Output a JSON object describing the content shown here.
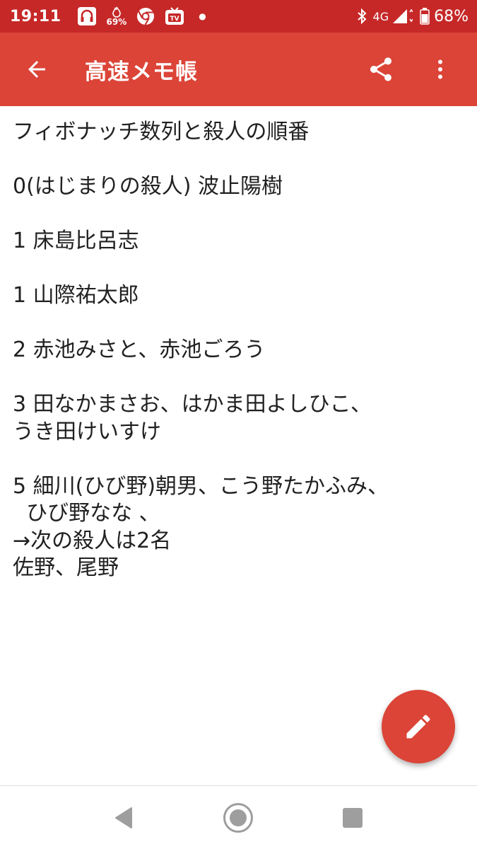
{
  "status_bar": {
    "time": "19:11",
    "notification_icons": [
      "media-app-icon",
      "fire-percent-icon",
      "chrome-icon",
      "tv-app-icon",
      "more-dot-icon"
    ],
    "fire_percent": "69%",
    "network_label": "4G",
    "battery_percent": "68%",
    "background_color": "#c62828"
  },
  "app_bar": {
    "title": "高速メモ帳",
    "background_color": "#db4437",
    "back_icon": "arrow-back-icon",
    "share_icon": "share-icon",
    "overflow_icon": "more-vert-icon"
  },
  "memo": {
    "text": "フィボナッチ数列と殺人の順番\n\n0(はじまりの殺人) 波止陽樹\n\n1 床島比呂志\n\n1 山際祐太郎\n\n2 赤池みさと、赤池ごろう\n\n3 田なかまさお、はかま田よしひこ、\nうき田けいすけ\n\n5 細川(ひび野)朝男、こう野たかふみ、\n  ひび野なな 、\n→次の殺人は2名\n佐野、尾野"
  },
  "fab": {
    "icon": "pencil-icon",
    "color": "#db4437"
  },
  "nav_bar": {
    "back_icon": "nav-back-icon",
    "home_icon": "nav-home-icon",
    "recents_icon": "nav-recents-icon"
  }
}
